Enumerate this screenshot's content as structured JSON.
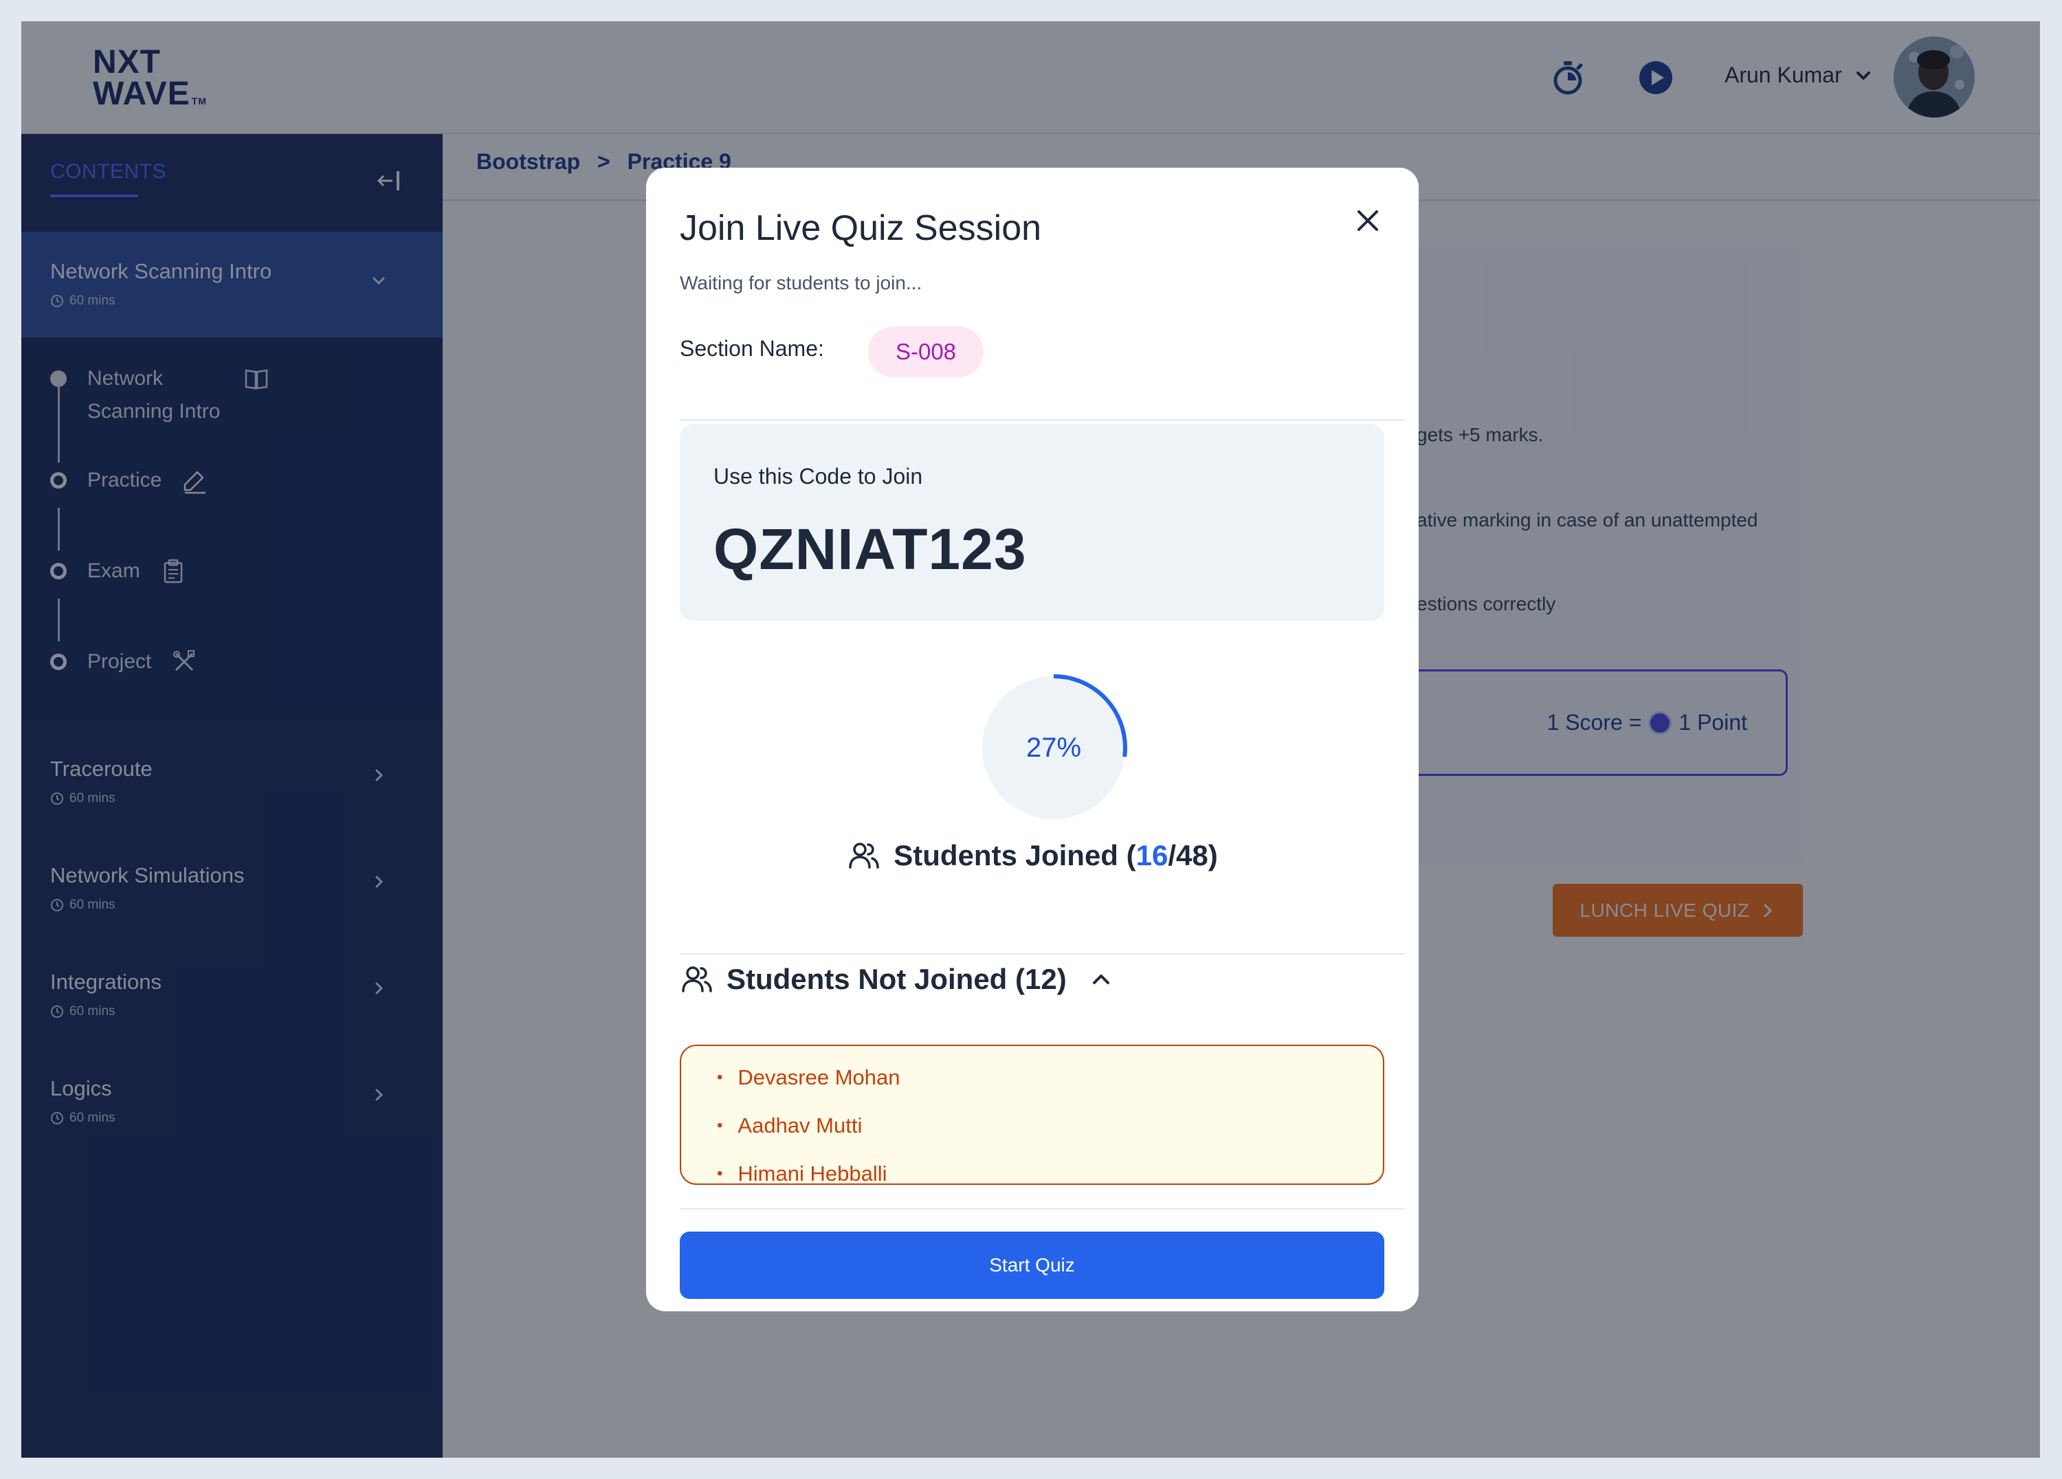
{
  "header": {
    "logo_line1": "NXT",
    "logo_line2": "WAVE",
    "logo_tm": "TM",
    "user_name": "Arun Kumar"
  },
  "sidebar": {
    "tab_label": "CONTENTS",
    "active_module": {
      "title": "Network Scanning Intro",
      "duration": "60 mins"
    },
    "steps": [
      {
        "label": "Network Scanning Intro",
        "status": "completed"
      },
      {
        "label": "Practice",
        "status": "current"
      },
      {
        "label": "Exam",
        "status": "pending"
      },
      {
        "label": "Project",
        "status": "pending"
      }
    ],
    "modules": [
      {
        "title": "Traceroute",
        "duration": "60 mins"
      },
      {
        "title": "Network Simulations",
        "duration": "60 mins"
      },
      {
        "title": "Integrations",
        "duration": "60 mins"
      },
      {
        "title": "Logics",
        "duration": "60 mins"
      }
    ]
  },
  "breadcrumb": {
    "parent": "Bootstrap",
    "separator": ">",
    "current": "Practice 9"
  },
  "content": {
    "line1": "gets +5 marks.",
    "line2": "ative marking in case of an unattempted",
    "line3": "estions correctly",
    "score_left": "1 Score =",
    "score_right": "1 Point",
    "launch_button": "LUNCH LIVE QUIZ"
  },
  "modal": {
    "title": "Join Live Quiz Session",
    "subtitle": "Waiting for students to join...",
    "section_label": "Section Name:",
    "section_value": "S-008",
    "code_label": "Use this Code to Join",
    "code": "QZNIAT123",
    "progress_percent": 27,
    "progress_label": "27%",
    "joined_prefix": "Students Joined (",
    "joined_count": "16",
    "joined_total": "/48)",
    "not_joined_label": "Students Not Joined (12)",
    "not_joined_students": [
      "Devasree Mohan",
      "Aadhav Mutti",
      "Himani Hebballi"
    ],
    "start_button": "Start Quiz"
  },
  "colors": {
    "primary": "#2563eb",
    "sidebar": "#1c2b5e",
    "accent_orange": "#f97316",
    "badge_pink": "#a21caf"
  },
  "icons": [
    "timer-icon",
    "play-icon",
    "chevron-down-icon",
    "collapse-sidebar-icon",
    "clock-icon",
    "book-icon",
    "edit-icon",
    "clipboard-icon",
    "tools-icon",
    "chevron-right-icon",
    "close-icon",
    "users-icon",
    "chevron-up-icon",
    "coin-icon"
  ]
}
